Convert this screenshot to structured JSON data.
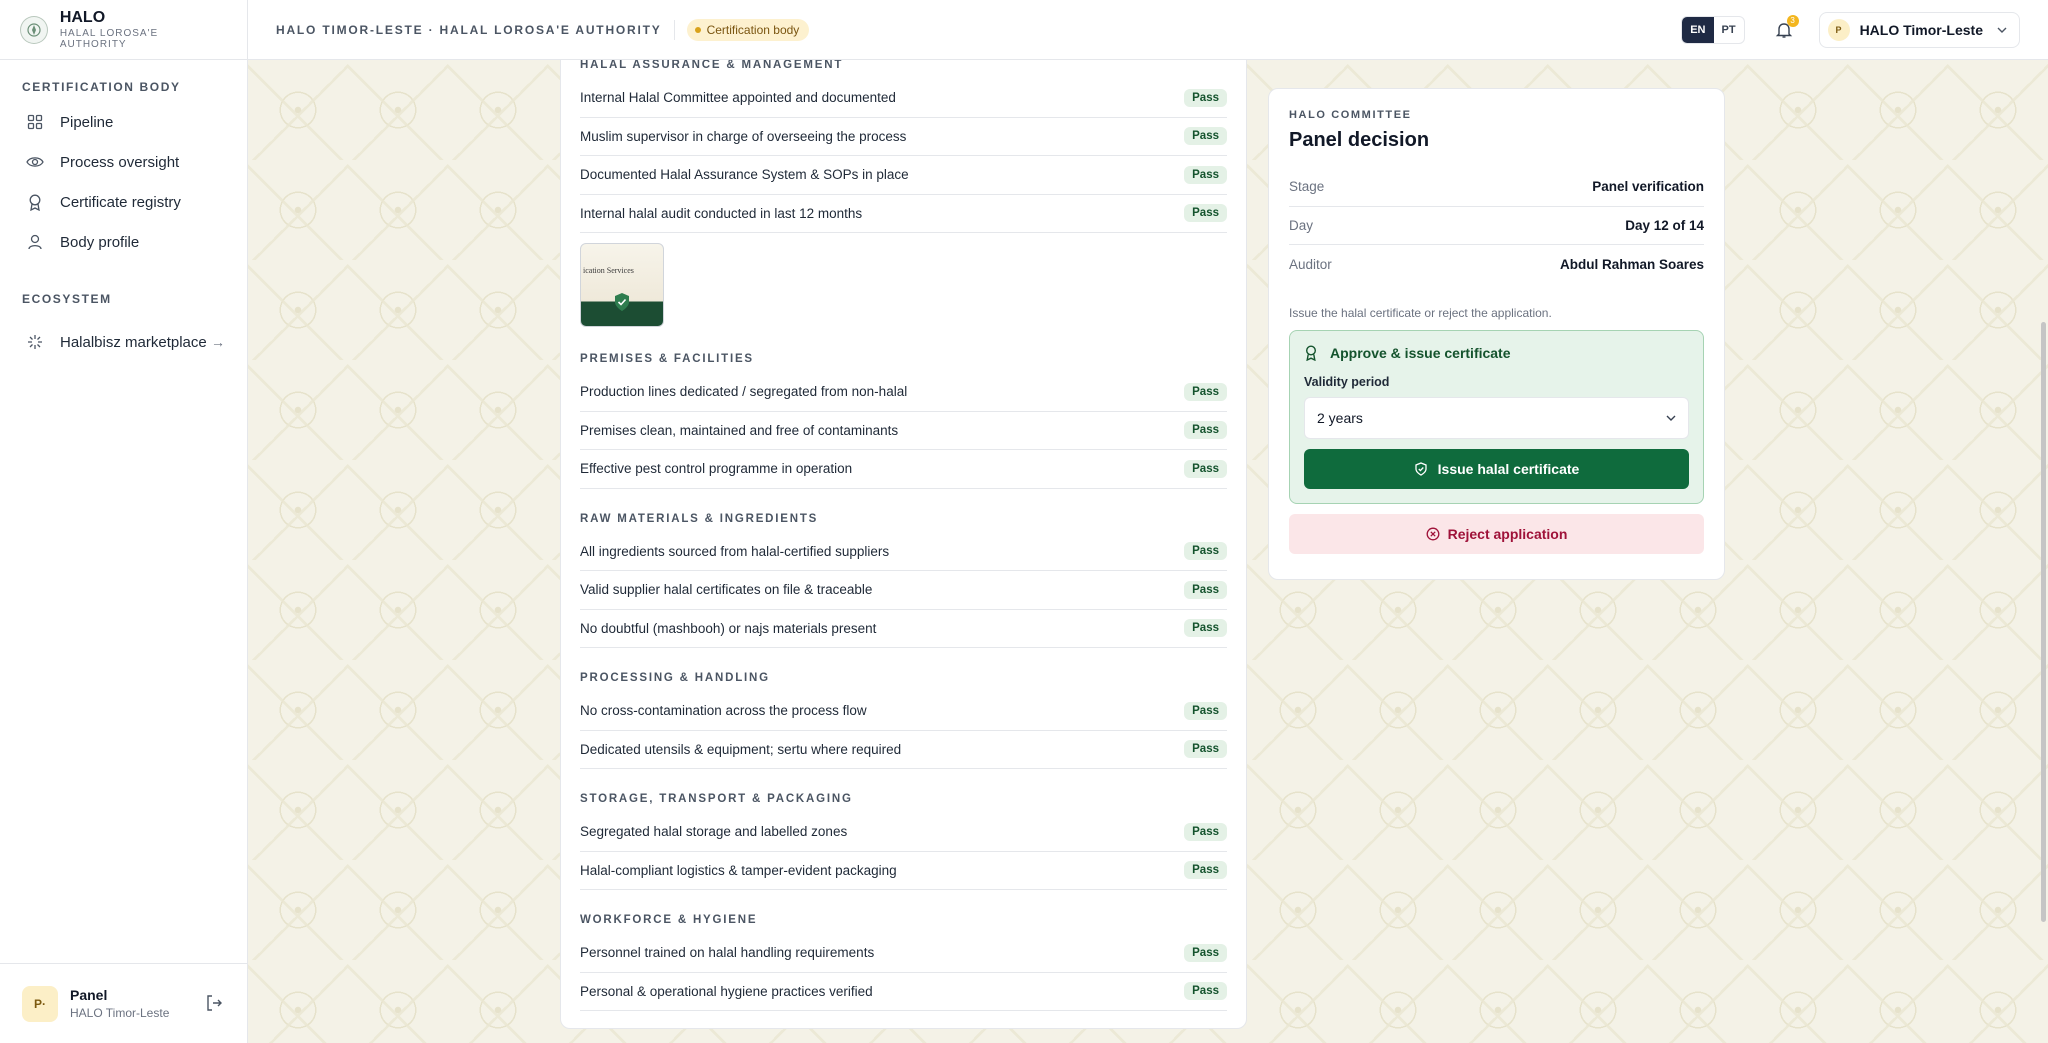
{
  "brand": {
    "name": "HALO",
    "subtitle": "HALAL LOROSA'E AUTHORITY"
  },
  "sidebar": {
    "section1": "CERTIFICATION BODY",
    "items": [
      {
        "label": "Pipeline",
        "icon": "grid-icon"
      },
      {
        "label": "Process oversight",
        "icon": "eye-icon"
      },
      {
        "label": "Certificate registry",
        "icon": "award-icon"
      },
      {
        "label": "Body profile",
        "icon": "user-icon"
      }
    ],
    "section2": "ECOSYSTEM",
    "ecosystem": {
      "label": "Halalbisz marketplace",
      "icon": "sparkle-icon"
    }
  },
  "user": {
    "initials": "P·",
    "name": "Panel",
    "org": "HALO Timor-Leste"
  },
  "header": {
    "breadcrumb": "HALO TIMOR-LESTE · HALAL LOROSA'E AUTHORITY",
    "role": "Certification body",
    "lang_en": "EN",
    "lang_pt": "PT",
    "notifications": "3",
    "org_initial": "P",
    "org_name": "HALO Timor-Leste"
  },
  "checklist": {
    "pass_label": "Pass",
    "evidence_caption": "ication Services",
    "sections": [
      {
        "title": "HALAL ASSURANCE & MANAGEMENT",
        "items": [
          "Internal Halal Committee appointed and documented",
          "Muslim supervisor in charge of overseeing the process",
          "Documented Halal Assurance System & SOPs in place",
          "Internal halal audit conducted in last 12 months"
        ]
      },
      {
        "title": "PREMISES & FACILITIES",
        "items": [
          "Production lines dedicated / segregated from non-halal",
          "Premises clean, maintained and free of contaminants",
          "Effective pest control programme in operation"
        ]
      },
      {
        "title": "RAW MATERIALS & INGREDIENTS",
        "items": [
          "All ingredients sourced from halal-certified suppliers",
          "Valid supplier halal certificates on file & traceable",
          "No doubtful (mashbooh) or najs materials present"
        ]
      },
      {
        "title": "PROCESSING & HANDLING",
        "items": [
          "No cross-contamination across the process flow",
          "Dedicated utensils & equipment; sertu where required"
        ]
      },
      {
        "title": "STORAGE, TRANSPORT & PACKAGING",
        "items": [
          "Segregated halal storage and labelled zones",
          "Halal-compliant logistics & tamper-evident packaging"
        ]
      },
      {
        "title": "WORKFORCE & HYGIENE",
        "items": [
          "Personnel trained on halal handling requirements",
          "Personal & operational hygiene practices verified"
        ]
      }
    ]
  },
  "decision": {
    "eyebrow": "HALO COMMITTEE",
    "title": "Panel decision",
    "rows": [
      {
        "key": "Stage",
        "value": "Panel verification"
      },
      {
        "key": "Day",
        "value": "Day 12 of 14"
      },
      {
        "key": "Auditor",
        "value": "Abdul Rahman Soares"
      }
    ],
    "hint": "Issue the halal certificate or reject the application.",
    "approve_title": "Approve & issue certificate",
    "validity_label": "Validity period",
    "validity_value": "2 years",
    "issue_label": "Issue halal certificate",
    "reject_label": "Reject application"
  },
  "colors": {
    "primary": "#0f6b3d",
    "accent": "#d9a21b",
    "danger": "#9f1239",
    "navy": "#1f2a44"
  }
}
